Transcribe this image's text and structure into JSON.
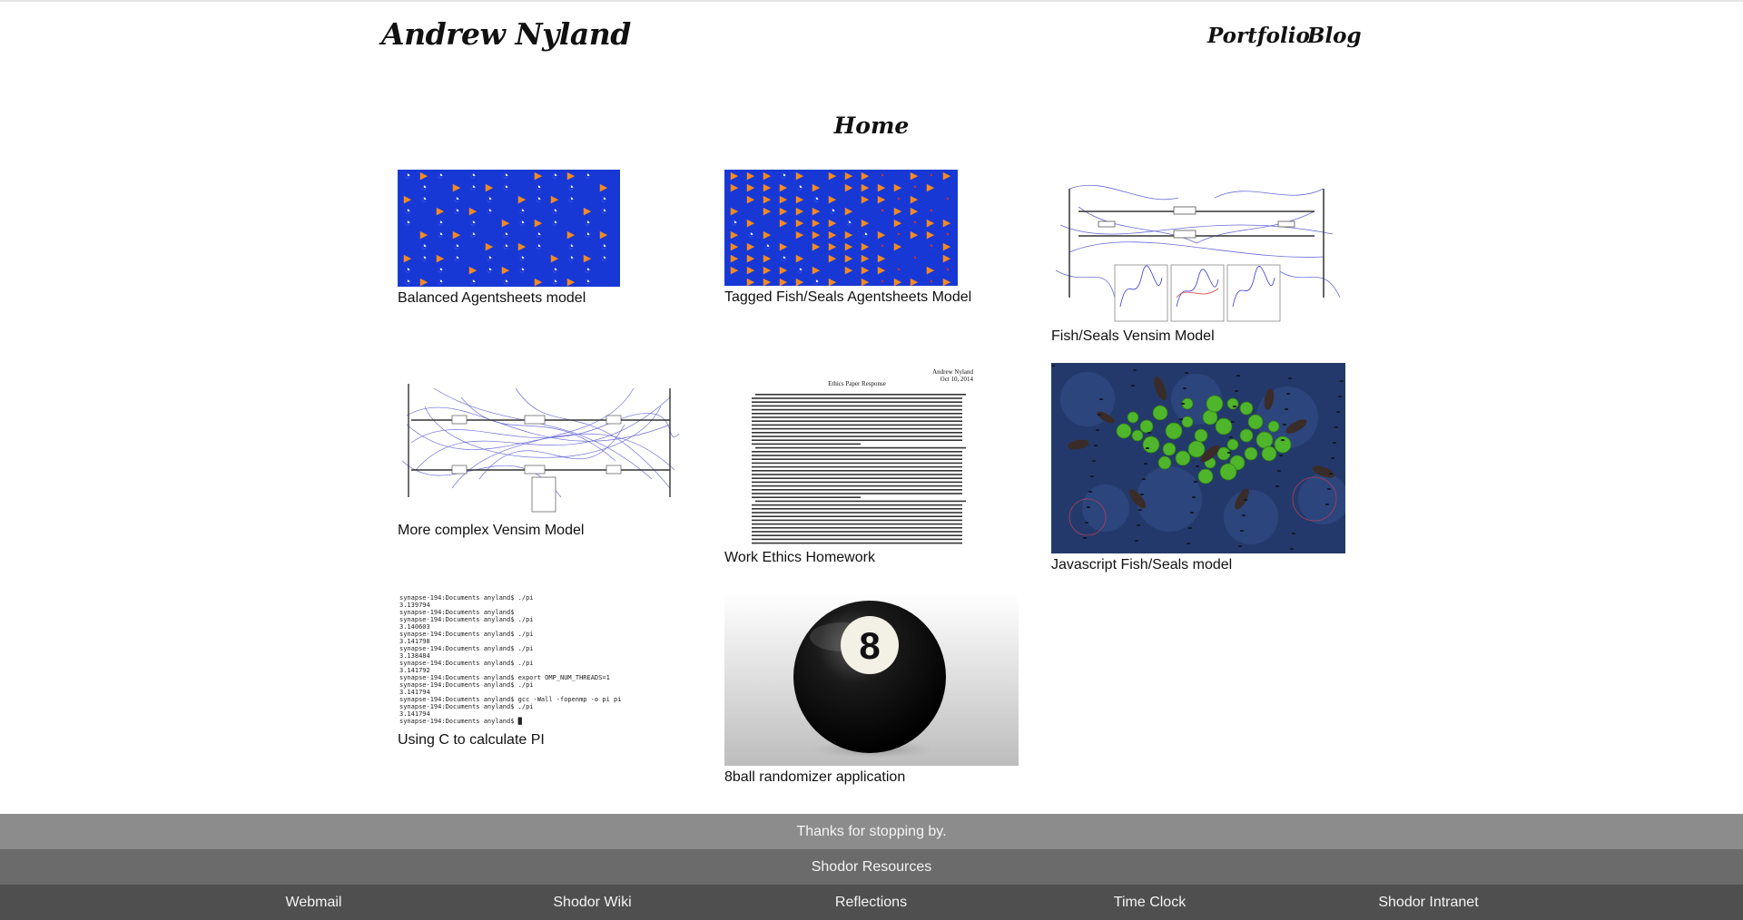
{
  "header": {
    "brand": "Andrew Nyland",
    "nav": [
      "Portfolio",
      "Blog"
    ]
  },
  "page_title": "Home",
  "projects": [
    {
      "caption": "Balanced Agentsheets model"
    },
    {
      "caption": "Tagged Fish/Seals Agentsheets Model"
    },
    {
      "caption": "Fish/Seals Vensim Model"
    },
    {
      "caption": "More complex Vensim Model"
    },
    {
      "caption": "Work Ethics Homework"
    },
    {
      "caption": "Javascript Fish/Seals model"
    },
    {
      "caption": "Using C to calculate PI"
    },
    {
      "caption": "8ball randomizer application"
    }
  ],
  "paper": {
    "author": "Andrew Nyland",
    "date": "Oct 10, 2014",
    "title": "Ethics Paper Response"
  },
  "terminal_lines": [
    "synapse-194:Documents anyland$ ./pi",
    "3.139794",
    "synapse-194:Documents anyland$",
    "synapse-194:Documents anyland$ ./pi",
    "3.140603",
    "synapse-194:Documents anyland$ ./pi",
    "3.141798",
    "synapse-194:Documents anyland$ ./pi",
    "3.138484",
    "synapse-194:Documents anyland$ ./pi",
    "3.141792",
    "synapse-194:Documents anyland$ export OMP_NUM_THREADS=1",
    "synapse-194:Documents anyland$ ./pi",
    "3.141794",
    "synapse-194:Documents anyland$ gcc -Wall -fopenmp -o pi pi.c",
    "synapse-194:Documents anyland$ ./pi",
    "3.141794",
    "synapse-194:Documents anyland$ █"
  ],
  "eightball_number": "8",
  "footer": {
    "thanks": "Thanks for stopping by.",
    "resources_title": "Shodor Resources",
    "links": [
      "Webmail",
      "Shodor Wiki",
      "Reflections",
      "Time Clock",
      "Shodor Intranet"
    ]
  },
  "colors": {
    "agent_bg": "#1838d6",
    "pond_bg": "#24396b",
    "footer_light": "#8c8c8c",
    "footer_mid": "#6b6b6b",
    "footer_dark": "#4f4f4f"
  }
}
